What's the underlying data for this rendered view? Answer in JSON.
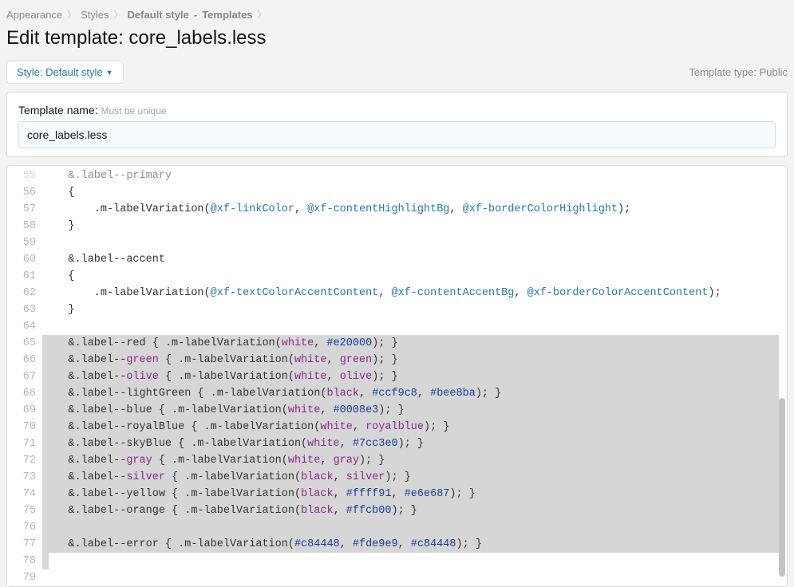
{
  "breadcrumbs": {
    "items": [
      {
        "label": "Appearance",
        "bold": false
      },
      {
        "label": "Styles",
        "bold": false
      },
      {
        "label": "Default style",
        "bold": true
      },
      {
        "sep": "-"
      },
      {
        "label": "Templates",
        "bold": true
      }
    ]
  },
  "page_title": "Edit template: core_labels.less",
  "style_button": {
    "prefix": "Style: ",
    "value": "Default style"
  },
  "template_type": "Template type: Public",
  "template_name": {
    "label": "Template name:",
    "hint": "Must be unique",
    "value": "core_labels.less"
  },
  "editor": {
    "first_line": 55,
    "lines": [
      {
        "n": 55,
        "raw": "    &.label--primary",
        "dim": true
      },
      {
        "n": 56,
        "raw": "    {"
      },
      {
        "n": 57,
        "raw": "        .m-labelVariation(@xf-linkColor, @xf-contentHighlightBg, @xf-borderColorHighlight);"
      },
      {
        "n": 58,
        "raw": "    }"
      },
      {
        "n": 59,
        "raw": ""
      },
      {
        "n": 60,
        "raw": "    &.label--accent"
      },
      {
        "n": 61,
        "raw": "    {"
      },
      {
        "n": 62,
        "raw": "        .m-labelVariation(@xf-textColorAccentContent, @xf-contentAccentBg, @xf-borderColorAccentContent);"
      },
      {
        "n": 63,
        "raw": "    }"
      },
      {
        "n": 64,
        "raw": ""
      },
      {
        "n": 65,
        "raw": "    &.label--red { .m-labelVariation(white, #e20000); }",
        "sel": true
      },
      {
        "n": 66,
        "raw": "    &.label--green { .m-labelVariation(white, green); }",
        "sel": true
      },
      {
        "n": 67,
        "raw": "    &.label--olive { .m-labelVariation(white, olive); }",
        "sel": true
      },
      {
        "n": 68,
        "raw": "    &.label--lightGreen { .m-labelVariation(black, #ccf9c8, #bee8ba); }",
        "sel": true
      },
      {
        "n": 69,
        "raw": "    &.label--blue { .m-labelVariation(white, #0008e3); }",
        "sel": true
      },
      {
        "n": 70,
        "raw": "    &.label--royalBlue { .m-labelVariation(white, royalblue); }",
        "sel": true
      },
      {
        "n": 71,
        "raw": "    &.label--skyBlue { .m-labelVariation(white, #7cc3e0); }",
        "sel": true
      },
      {
        "n": 72,
        "raw": "    &.label--gray { .m-labelVariation(white, gray); }",
        "sel": true
      },
      {
        "n": 73,
        "raw": "    &.label--silver { .m-labelVariation(black, silver); }",
        "sel": true
      },
      {
        "n": 74,
        "raw": "    &.label--yellow { .m-labelVariation(black, #ffff91, #e6e687); }",
        "sel": true
      },
      {
        "n": 75,
        "raw": "    &.label--orange { .m-labelVariation(black, #ffcb00); }",
        "sel": true
      },
      {
        "n": 76,
        "raw": "",
        "sel": true
      },
      {
        "n": 77,
        "raw": "    &.label--error { .m-labelVariation(#c84448, #fde9e9, #c84448); }",
        "sel": true
      },
      {
        "n": 78,
        "raw": "}",
        "selshort": true
      },
      {
        "n": 79,
        "raw": ""
      }
    ]
  }
}
